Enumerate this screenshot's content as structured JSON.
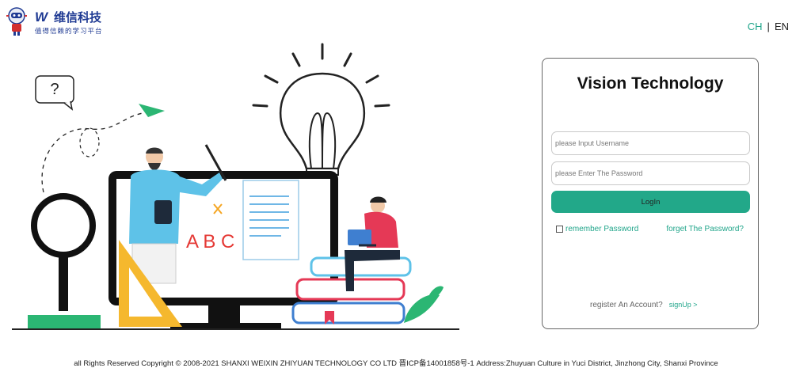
{
  "header": {
    "logo_mark": "W",
    "logo_name": "维信科技",
    "logo_tagline": "值得信赖的学习平台",
    "lang_ch": "CH",
    "lang_sep": "|",
    "lang_en": "EN"
  },
  "login": {
    "title": "Vision Technology",
    "username_placeholder": "please Input Username",
    "password_placeholder": "please Enter The Password",
    "login_button": "LogIn",
    "remember_label": "remember Password",
    "forget_link": "forget The Password?",
    "register_text": "register An Account?",
    "signup_link": "signUp  >"
  },
  "illustration": {
    "letters": "A B C",
    "question": "?"
  },
  "footer": {
    "text": "all Rights Reserved Copyright © 2008-2021 SHANXI  WEIXIN  ZHIYUAN  TECHNOLOGY  CO  LTD  晋ICP备14001858号-1 Address:Zhuyuan Culture in Yuci District, Jinzhong City, Shanxi Province"
  },
  "colors": {
    "accent": "#22a889",
    "brand": "#1f3a93"
  }
}
